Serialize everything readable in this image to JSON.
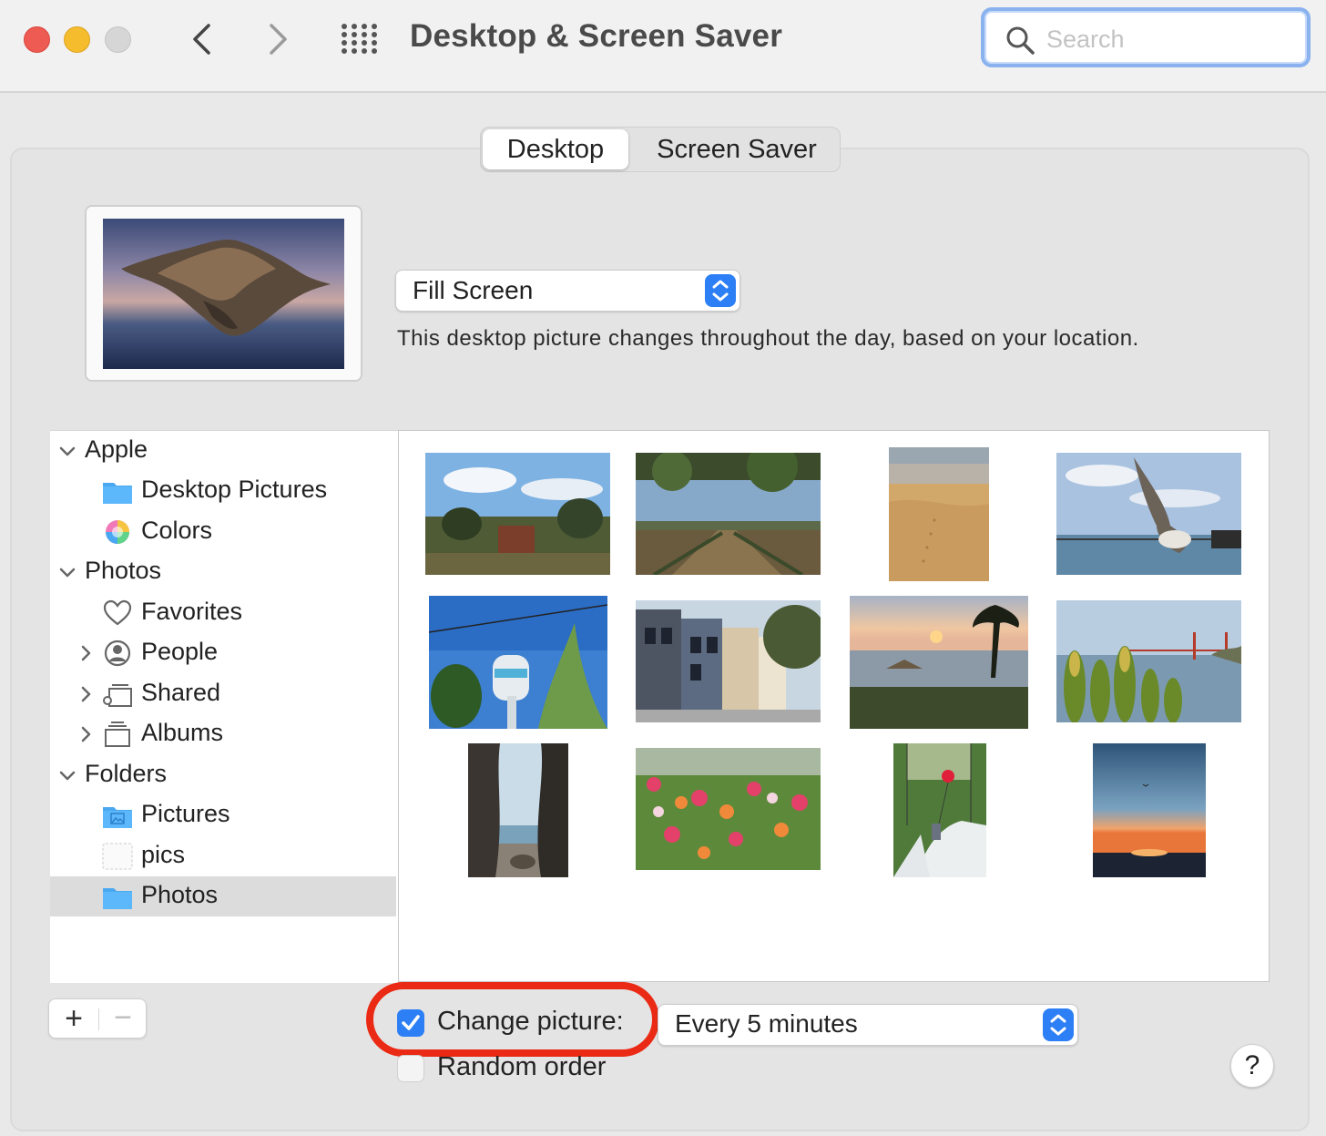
{
  "window": {
    "title": "Desktop & Screen Saver",
    "search_placeholder": "Search"
  },
  "tabs": [
    {
      "label": "Desktop",
      "active": true
    },
    {
      "label": "Screen Saver",
      "active": false
    }
  ],
  "preview": {
    "icon": "desktop-picture-preview"
  },
  "fill_mode": {
    "selected": "Fill Screen"
  },
  "description": "This desktop picture changes throughout the day, based on your location.",
  "sidebar": {
    "groups": [
      {
        "label": "Apple",
        "expanded": true
      },
      {
        "label": "Photos",
        "expanded": true
      },
      {
        "label": "Folders",
        "expanded": true
      }
    ],
    "items": [
      {
        "label": "Desktop Pictures",
        "icon": "folder-icon"
      },
      {
        "label": "Colors",
        "icon": "color-wheel-icon"
      },
      {
        "label": "Favorites",
        "icon": "heart-icon"
      },
      {
        "label": "People",
        "icon": "person-circle-icon"
      },
      {
        "label": "Shared",
        "icon": "shared-album-icon"
      },
      {
        "label": "Albums",
        "icon": "albums-icon"
      },
      {
        "label": "Pictures",
        "icon": "pictures-folder-icon"
      },
      {
        "label": "pics",
        "icon": "blank-folder-icon"
      },
      {
        "label": "Photos",
        "icon": "folder-icon",
        "selected": true
      }
    ]
  },
  "thumbnails": [
    "garden-landscape",
    "vineyard",
    "sand-dunes",
    "seagull-bridge",
    "water-tower",
    "row-houses",
    "beach-sunset-palm",
    "golden-gate-plants",
    "rock-cave-beach",
    "zinnia-flowers",
    "child-red-balloon",
    "ocean-sunset"
  ],
  "controls": {
    "change_picture_label": "Change picture:",
    "change_picture_checked": true,
    "interval": "Every 5 minutes",
    "random_order_label": "Random order",
    "random_order_checked": false,
    "help": "?",
    "add": "+",
    "remove": "−"
  },
  "colors": {
    "accent": "#2d7ff5",
    "highlight_ring": "#ea2a14",
    "close": "#ee5b52",
    "minimize": "#f5bd2e"
  }
}
